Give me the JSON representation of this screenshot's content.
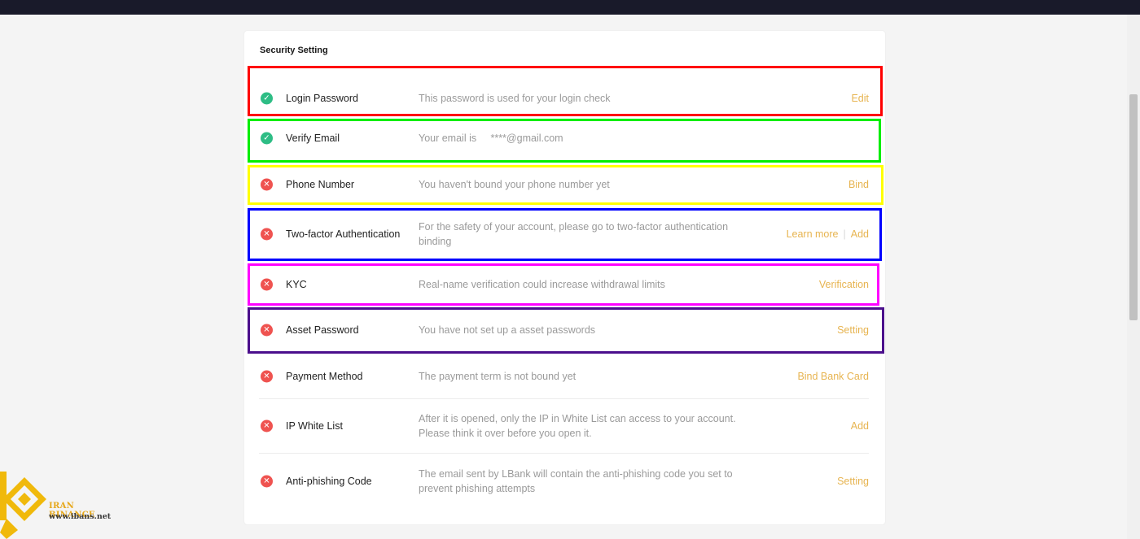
{
  "page": {
    "title": "Security Setting"
  },
  "rows": [
    {
      "name": "Login Password",
      "status": "ok",
      "desc": "This password is used for your login check",
      "actions": [
        "Edit"
      ]
    },
    {
      "name": "Verify Email",
      "status": "ok",
      "desc": "Your email is     ****@gmail.com",
      "actions": []
    },
    {
      "name": "Phone Number",
      "status": "bad",
      "desc": "You haven't bound your phone number yet",
      "actions": [
        "Bind"
      ]
    },
    {
      "name": "Two-factor Authentication",
      "status": "bad",
      "desc": "For the safety of your account, please go to two-factor authentication binding",
      "actions": [
        "Learn more",
        "Add"
      ]
    },
    {
      "name": "KYC",
      "status": "bad",
      "desc": "Real-name verification could increase withdrawal limits",
      "actions": [
        "Verification"
      ]
    },
    {
      "name": "Asset Password",
      "status": "bad",
      "desc": "You have not set up a asset passwords",
      "actions": [
        "Setting"
      ]
    },
    {
      "name": "Payment Method",
      "status": "bad",
      "desc": "The payment term is not bound yet",
      "actions": [
        "Bind Bank Card"
      ]
    },
    {
      "name": "IP White List",
      "status": "bad",
      "desc": "After it is opened, only the IP in White List can access to your account. Please think it over before you open it.",
      "actions": [
        "Add"
      ]
    },
    {
      "name": "Anti-phishing Code",
      "status": "bad",
      "desc": "The email sent by LBank will contain the anti-phishing code you set to prevent phishing attempts",
      "actions": [
        "Setting"
      ]
    }
  ],
  "highlight_colors": [
    "#ff0000",
    "#00ee00",
    "#ffff00",
    "#0000ff",
    "#ff00ff",
    "#4b0f8c"
  ],
  "colors": {
    "accent": "#e7b450",
    "ok": "#2ebd85",
    "bad": "#ef5350",
    "topbar": "#191a2a"
  },
  "icons": {
    "ok": "check-circle-icon",
    "bad": "x-circle-icon"
  },
  "watermark": {
    "line1": "IRAN BINANCE",
    "line2": "www.ibans.net"
  }
}
